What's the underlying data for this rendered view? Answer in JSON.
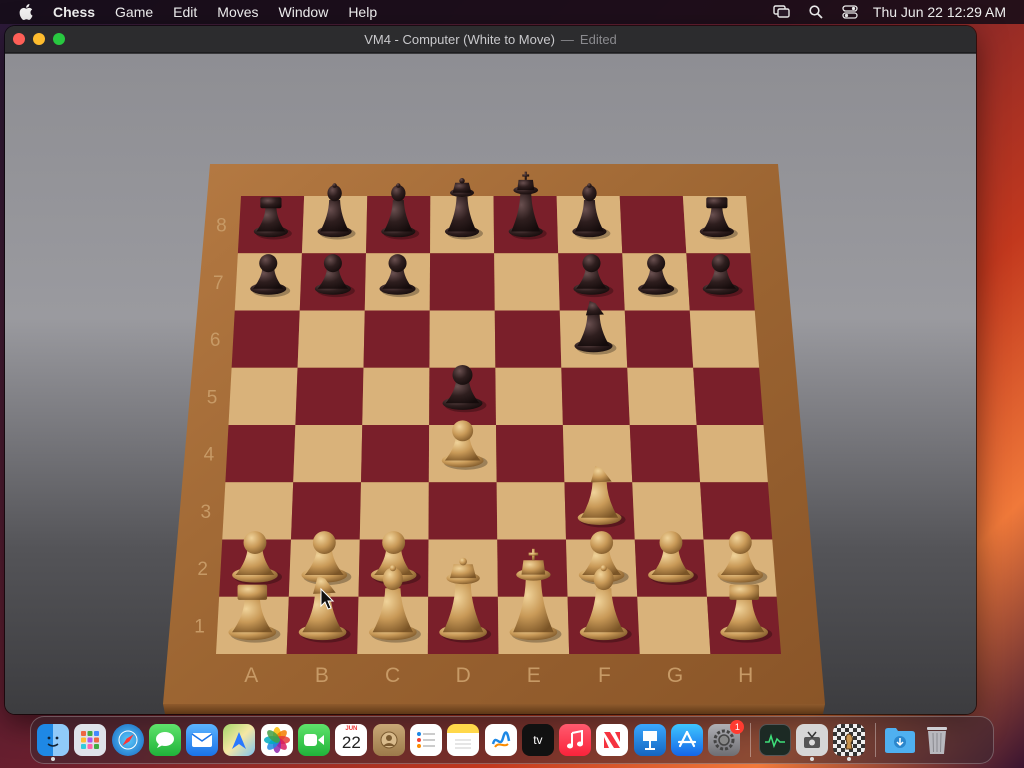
{
  "menubar": {
    "app_name": "Chess",
    "items": [
      "Game",
      "Edit",
      "Moves",
      "Window",
      "Help"
    ],
    "clock": "Thu Jun 22  12:29 AM"
  },
  "window": {
    "title": "VM4 - Computer   (White to Move)",
    "separator": "—",
    "edited": "Edited"
  },
  "board": {
    "files": [
      "A",
      "B",
      "C",
      "D",
      "E",
      "F",
      "G",
      "H"
    ],
    "ranks": [
      "1",
      "2",
      "3",
      "4",
      "5",
      "6",
      "7",
      "8"
    ],
    "light_square": "#d9b27a",
    "dark_square": "#7a1f2a",
    "frame_color": "#a86f3c",
    "pieces": [
      {
        "color": "white",
        "type": "rook",
        "square": "a1"
      },
      {
        "color": "white",
        "type": "knight",
        "square": "b1"
      },
      {
        "color": "white",
        "type": "bishop",
        "square": "c1"
      },
      {
        "color": "white",
        "type": "queen",
        "square": "d1"
      },
      {
        "color": "white",
        "type": "king",
        "square": "e1"
      },
      {
        "color": "white",
        "type": "bishop",
        "square": "f1"
      },
      {
        "color": "white",
        "type": "rook",
        "square": "h1"
      },
      {
        "color": "white",
        "type": "pawn",
        "square": "a2"
      },
      {
        "color": "white",
        "type": "pawn",
        "square": "b2"
      },
      {
        "color": "white",
        "type": "pawn",
        "square": "c2"
      },
      {
        "color": "white",
        "type": "pawn",
        "square": "f2"
      },
      {
        "color": "white",
        "type": "pawn",
        "square": "g2"
      },
      {
        "color": "white",
        "type": "pawn",
        "square": "h2"
      },
      {
        "color": "white",
        "type": "knight",
        "square": "f3"
      },
      {
        "color": "white",
        "type": "pawn",
        "square": "d4"
      },
      {
        "color": "black",
        "type": "rook",
        "square": "a8"
      },
      {
        "color": "black",
        "type": "bishop",
        "square": "b8"
      },
      {
        "color": "black",
        "type": "bishop",
        "square": "c8"
      },
      {
        "color": "black",
        "type": "queen",
        "square": "d8"
      },
      {
        "color": "black",
        "type": "king",
        "square": "e8"
      },
      {
        "color": "black",
        "type": "bishop",
        "square": "f8"
      },
      {
        "color": "black",
        "type": "rook",
        "square": "h8"
      },
      {
        "color": "black",
        "type": "pawn",
        "square": "a7"
      },
      {
        "color": "black",
        "type": "pawn",
        "square": "b7"
      },
      {
        "color": "black",
        "type": "pawn",
        "square": "c7"
      },
      {
        "color": "black",
        "type": "pawn",
        "square": "f7"
      },
      {
        "color": "black",
        "type": "pawn",
        "square": "g7"
      },
      {
        "color": "black",
        "type": "pawn",
        "square": "h7"
      },
      {
        "color": "black",
        "type": "knight",
        "square": "f6"
      },
      {
        "color": "black",
        "type": "pawn",
        "square": "d5"
      }
    ]
  },
  "dock": {
    "calendar_month": "JUN",
    "calendar_day": "22",
    "settings_badge": "1",
    "tv_label": "tv",
    "apps": [
      "finder",
      "launchpad",
      "safari",
      "messages",
      "mail",
      "maps",
      "photos",
      "facetime",
      "calendar",
      "contacts",
      "reminders",
      "notes",
      "freeform",
      "tv",
      "music",
      "news",
      "keynote",
      "app-store",
      "system-settings",
      "activity-monitor",
      "screenshot",
      "chess",
      "downloads",
      "trash"
    ]
  }
}
